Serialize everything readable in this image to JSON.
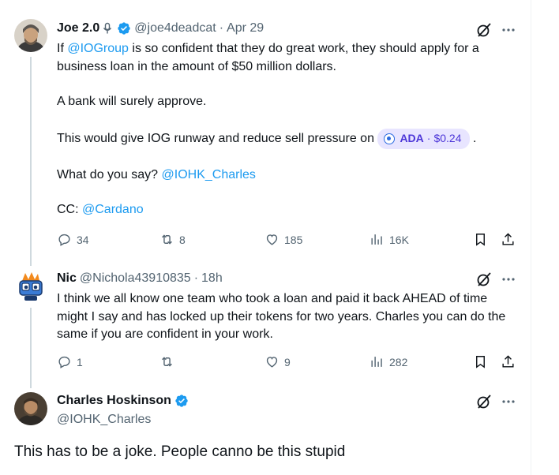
{
  "tweets": [
    {
      "name": "Joe 2.0",
      "handle": "@joe4deadcat",
      "separator": "·",
      "time": "Apr 29",
      "text": {
        "p1_a": "If ",
        "p1_mention": "@IOGroup",
        "p1_b": " is so confident that they do great work, they should apply for a business loan in the amount of $50 million dollars.",
        "p2": "A bank will surely approve.",
        "p3": "This would give IOG runway and reduce sell pressure on",
        "cashtag_symbol": "ADA",
        "cashtag_sep": "·",
        "cashtag_price": "$0.24",
        "p3_end": ".",
        "p4_a": "What do you say? ",
        "p4_mention": "@IOHK_Charles",
        "p5_a": "CC: ",
        "p5_mention": "@Cardano"
      },
      "replies": "34",
      "reposts": "8",
      "likes": "185",
      "views": "16K"
    },
    {
      "name": "Nic",
      "handle": "@Nichola43910835",
      "separator": "·",
      "time": "18h",
      "text": "I think we all know one team who took a loan and paid it back AHEAD of time might I say and has locked up their tokens for two years. Charles you can do the same if you are confident in your work.",
      "replies": "1",
      "reposts": "",
      "likes": "9",
      "views": "282"
    }
  ],
  "main_tweet": {
    "name": "Charles Hoskinson",
    "handle": "@IOHK_Charles",
    "text": "This has to be a joke. People canno be this stupid"
  },
  "colors": {
    "accent": "#1d9bf0",
    "muted": "#536471",
    "cashtag_bg": "#e8e5ff",
    "cashtag_text": "#4c36d8"
  }
}
